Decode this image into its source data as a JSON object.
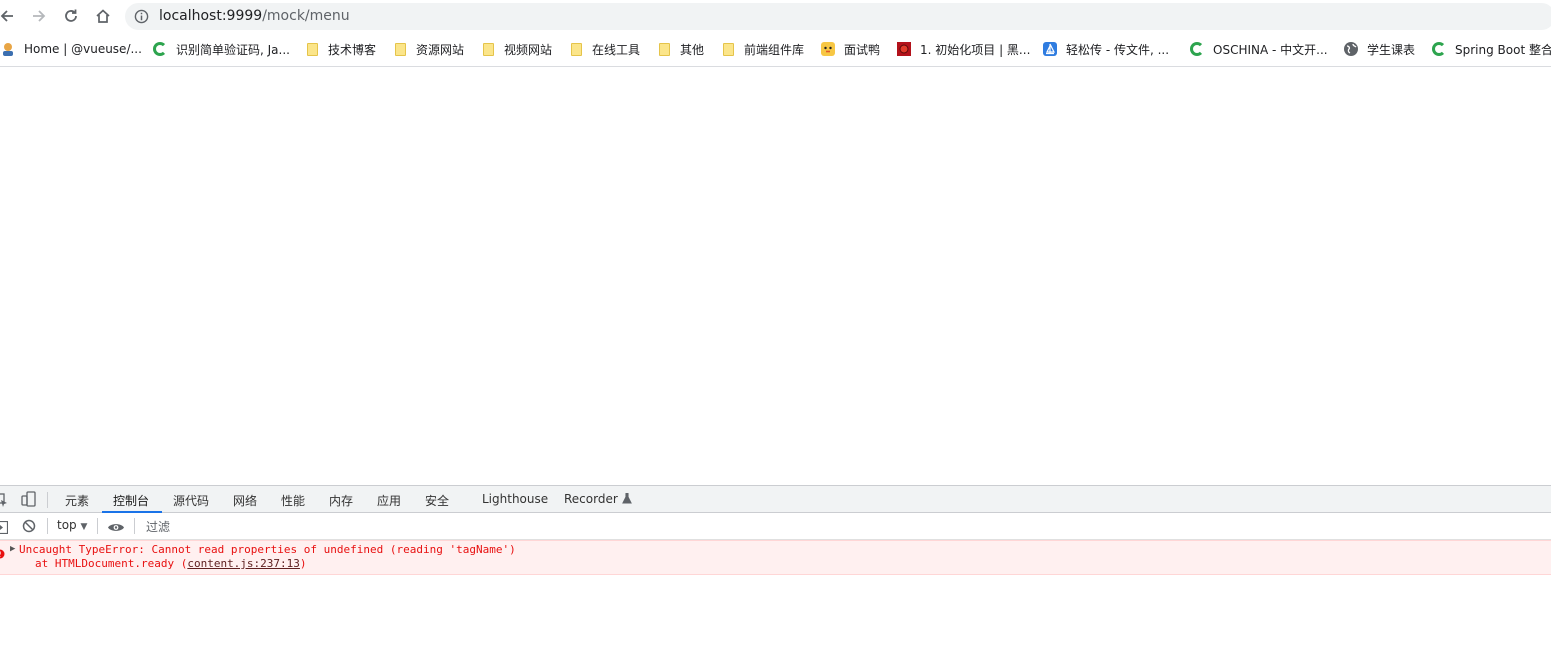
{
  "browser": {
    "url_host": "localhost:9999",
    "url_path": "/mock/menu"
  },
  "bookmarks": [
    {
      "label": "Home | @vueuse/...",
      "icon": "vueuse-icon"
    },
    {
      "label": "识别简单验证码, Ja...",
      "icon": "green-c-icon"
    },
    {
      "label": "技术博客",
      "icon": "folder-icon"
    },
    {
      "label": "资源网站",
      "icon": "folder-icon"
    },
    {
      "label": "视频网站",
      "icon": "folder-icon"
    },
    {
      "label": "在线工具",
      "icon": "folder-icon"
    },
    {
      "label": "其他",
      "icon": "folder-icon"
    },
    {
      "label": "前端组件库",
      "icon": "folder-icon"
    },
    {
      "label": "面试鸭",
      "icon": "duck-icon"
    },
    {
      "label": "1. 初始化项目 | 黑...",
      "icon": "red-logo-icon"
    },
    {
      "label": "轻松传 - 传文件, ...",
      "icon": "sail-icon"
    },
    {
      "label": "OSCHINA - 中文开...",
      "icon": "green-c-icon"
    },
    {
      "label": "学生课表",
      "icon": "globe-icon"
    },
    {
      "label": "Spring Boot 整合",
      "icon": "green-c-icon"
    }
  ],
  "devtools": {
    "tabs": [
      "元素",
      "控制台",
      "源代码",
      "网络",
      "性能",
      "内存",
      "应用",
      "安全",
      "Lighthouse",
      "Recorder"
    ],
    "active_tab": "控制台",
    "context": "top",
    "filter_placeholder": "过滤",
    "error": {
      "line1": "Uncaught TypeError: Cannot read properties of undefined (reading 'tagName')",
      "line2_prefix": "at HTMLDocument.ready (",
      "line2_link": "content.js:237:13",
      "line2_suffix": ")"
    }
  },
  "colors": {
    "accent": "#1a73e8",
    "error": "#e81010",
    "error_bg": "#fff0f0"
  }
}
